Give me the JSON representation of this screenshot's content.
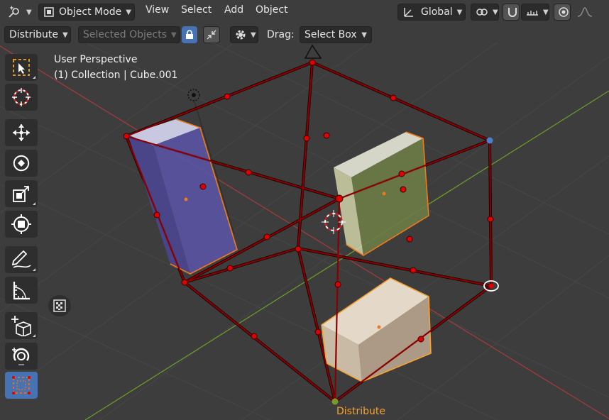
{
  "header": {
    "mode_label": "Object Mode",
    "menus": [
      "View",
      "Select",
      "Add",
      "Object"
    ],
    "orientation_label": "Global"
  },
  "tool_settings": {
    "tool_label": "Distribute",
    "target_label": "Selected Objects",
    "drag_label": "Drag:",
    "drag_value": "Select Box"
  },
  "viewport": {
    "perspective_label": "User Perspective",
    "collection_label": "(1) Collection | Cube.001",
    "gizmo_label": "Distribute"
  },
  "toolbar": {
    "tools": [
      "select-box",
      "cursor",
      "move",
      "rotate",
      "scale",
      "transform",
      "annotate",
      "measure",
      "add-cube",
      "spin",
      "distribute"
    ],
    "active_tool": "distribute"
  },
  "colors": {
    "accent": "#4772b3",
    "cage": "#8a0000",
    "handle": "#e00000",
    "highlight": "#f5a231",
    "x_axis": "#a03c3c",
    "y_axis": "#6a9a2a"
  }
}
